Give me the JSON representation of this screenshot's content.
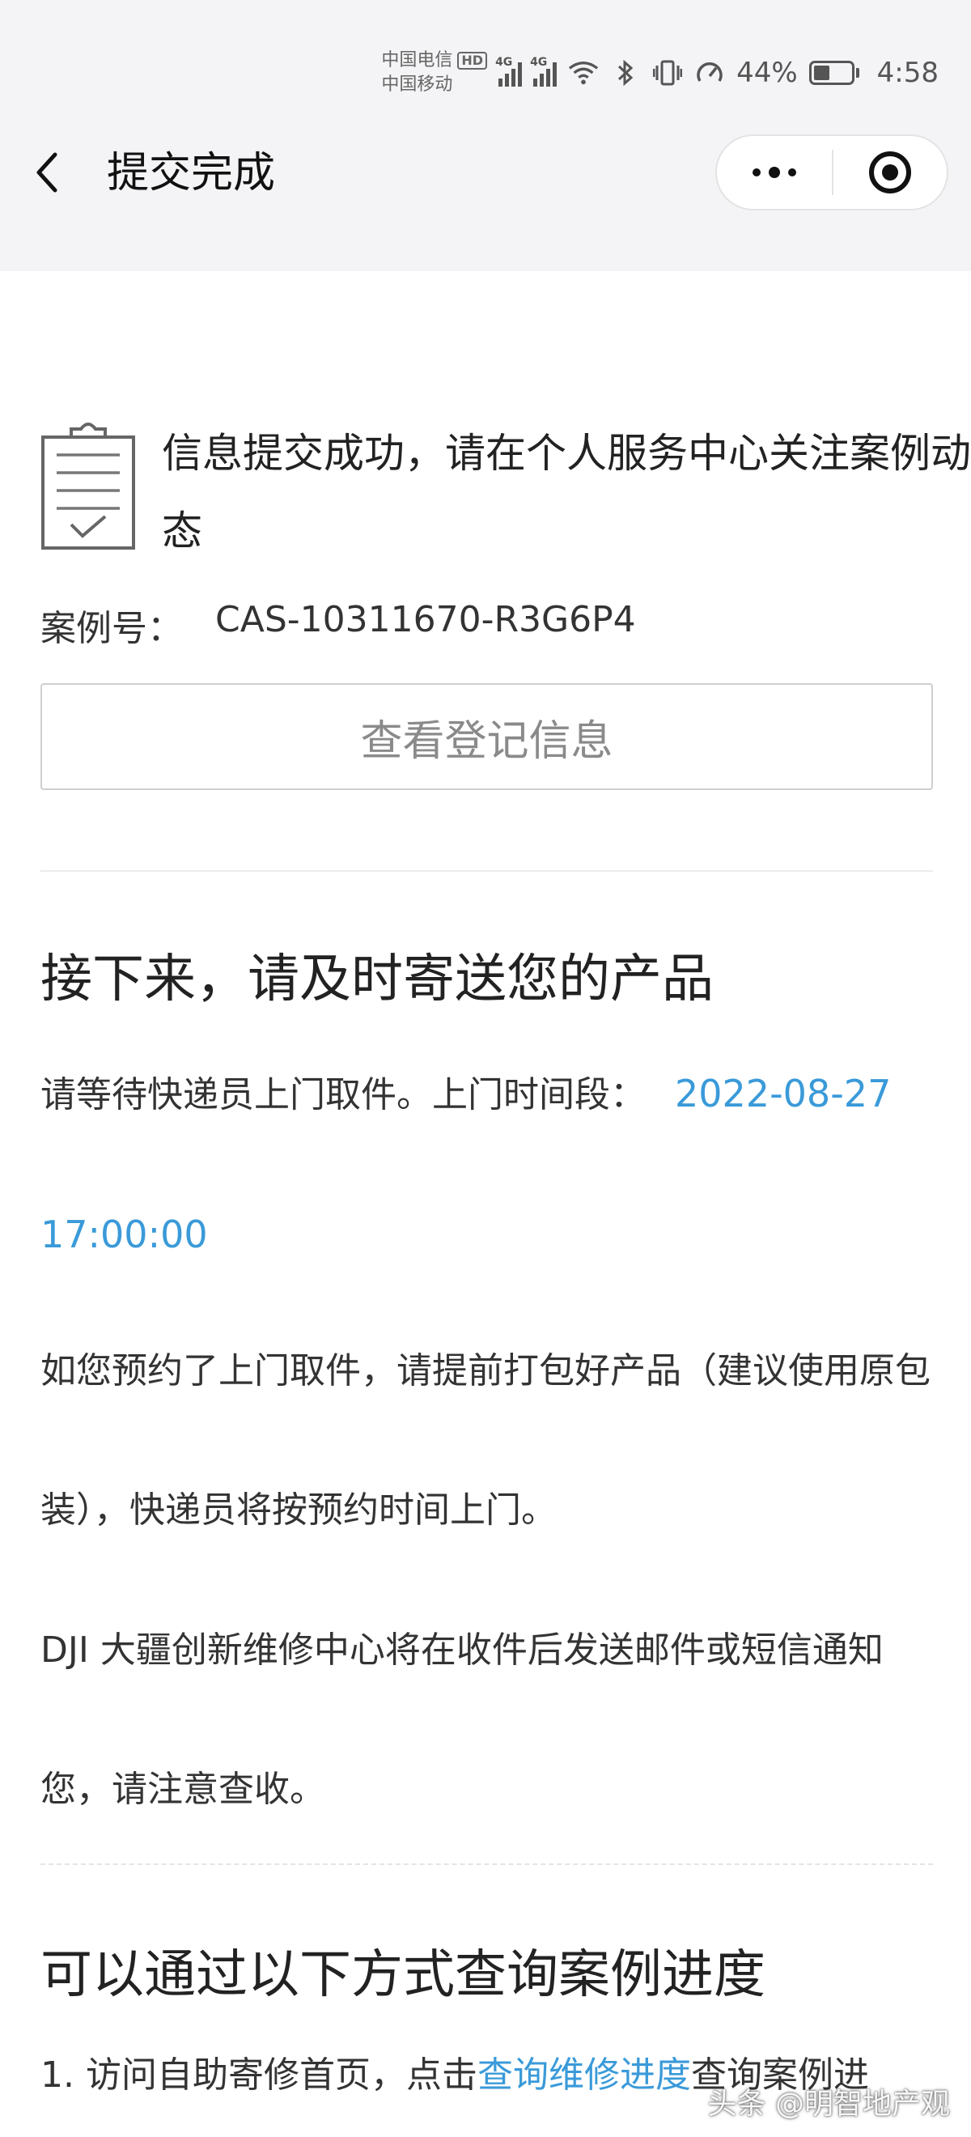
{
  "status_bar": {
    "carrier_1": "中国电信",
    "carrier_1_badge": "HD",
    "carrier_2": "中国移动",
    "network_label_1": "4G",
    "network_label_2": "4G",
    "battery_percent": "44%",
    "battery_level": 0.44,
    "time": "4:58",
    "icons": [
      "signal-icon",
      "signal-icon",
      "wifi-icon",
      "bluetooth-icon",
      "vibrate-icon",
      "speedometer-icon",
      "battery-icon"
    ]
  },
  "nav": {
    "title": "提交完成",
    "back_icon": "chevron-left-icon",
    "more_icon": "more-dots-icon",
    "close_icon": "record-icon"
  },
  "success": {
    "icon": "clipboard-check-icon",
    "message": "信息提交成功，请在个人服务中心关注案例动态",
    "case_label": "案例号：",
    "case_number": "CAS-10311670-R3G6P4",
    "view_button": "查看登记信息"
  },
  "next_steps": {
    "title": "接下来，请及时寄送您的产品",
    "wait_text": "请等待快递员上门取件。上门时间段：",
    "pickup_date": "2022-08-27",
    "pickup_time": "17:00:00",
    "pack_text": "如您预约了上门取件，请提前打包好产品（建议使用原包装），快递员将按预约时间上门。",
    "notify_text": "DJI 大疆创新维修中心将在收件后发送邮件或短信通知您，请注意查收。"
  },
  "progress": {
    "title": "可以通过以下方式查询案例进度",
    "item_1_prefix": "1. 访问自助寄修首页，点击",
    "item_1_link": "查询维修进度",
    "item_1_suffix": "查询案例进"
  },
  "watermark": "头条 @明智地产观"
}
